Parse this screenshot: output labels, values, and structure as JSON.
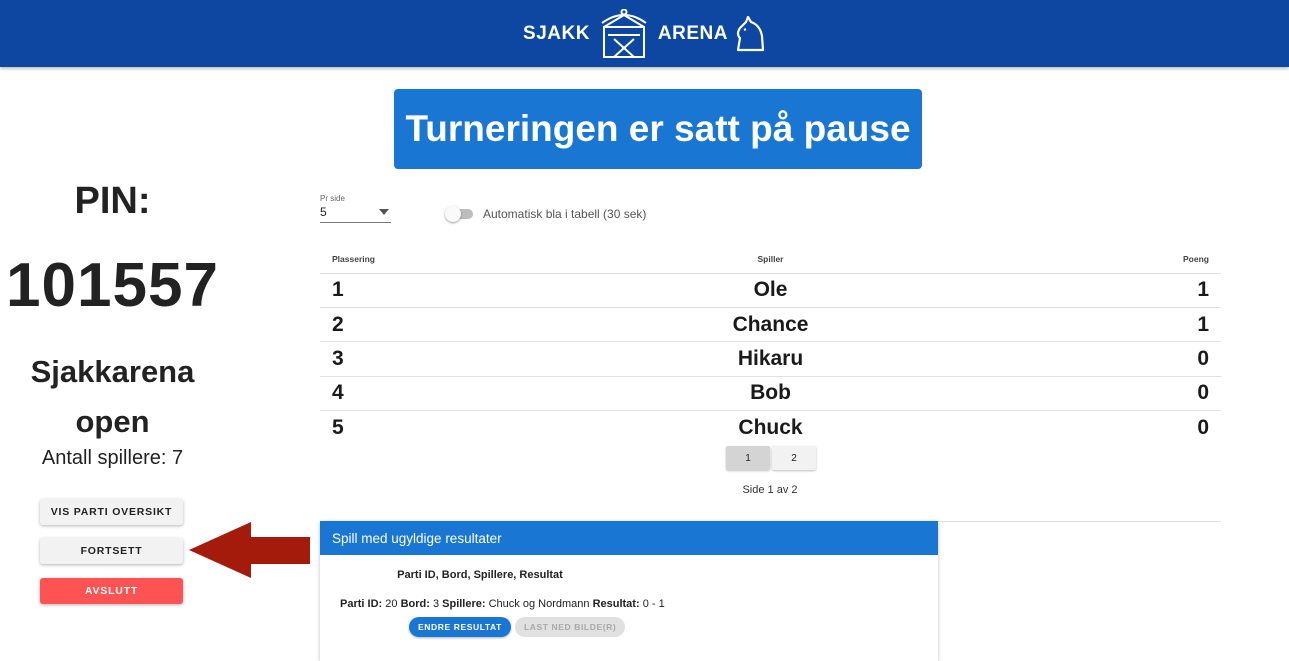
{
  "header": {
    "logo_left": "SJAKK",
    "logo_right": "ARENA"
  },
  "banner": {
    "text": "Turneringen er satt på pause"
  },
  "sidebar": {
    "pin_label": "PIN:",
    "pin_value": "101557",
    "tournament_name": "Sjakkarena open",
    "player_count": "Antall spillere: 7",
    "buttons": {
      "overview": "VIS PARTI OVERSIKT",
      "continue": "FORTSETT",
      "end": "AVSLUTT"
    }
  },
  "controls": {
    "per_page_label": "Pr side",
    "per_page_value": "5",
    "auto_scroll_label": "Automatisk bla i tabell (30 sek)",
    "auto_scroll_on": false
  },
  "standings": {
    "headers": [
      "Plassering",
      "Spiller",
      "Poeng"
    ],
    "rows": [
      {
        "place": "1",
        "player": "Ole",
        "points": "1"
      },
      {
        "place": "2",
        "player": "Chance",
        "points": "1"
      },
      {
        "place": "3",
        "player": "Hikaru",
        "points": "0"
      },
      {
        "place": "4",
        "player": "Bob",
        "points": "0"
      },
      {
        "place": "5",
        "player": "Chuck",
        "points": "0"
      }
    ]
  },
  "pagination": {
    "pages": [
      "1",
      "2"
    ],
    "current": 1,
    "info": "Side 1 av 2"
  },
  "invalid_results": {
    "title": "Spill med ugyldige resultater",
    "columns": "Parti ID, Bord, Spillere, Resultat",
    "game": {
      "id_label": "Parti ID:",
      "id": "20",
      "table_label": "Bord:",
      "table": "3",
      "players_label": "Spillere:",
      "players": "Chuck og Nordmann",
      "result_label": "Resultat:",
      "result": "0 - 1"
    },
    "actions": {
      "edit": "ENDRE RESULTAT",
      "download": "LAST NED BILDE(R)"
    }
  },
  "colors": {
    "topbar": "#0d47a1",
    "primary": "#1976d2",
    "danger": "#ff5252",
    "arrow": "#a51b0b"
  }
}
